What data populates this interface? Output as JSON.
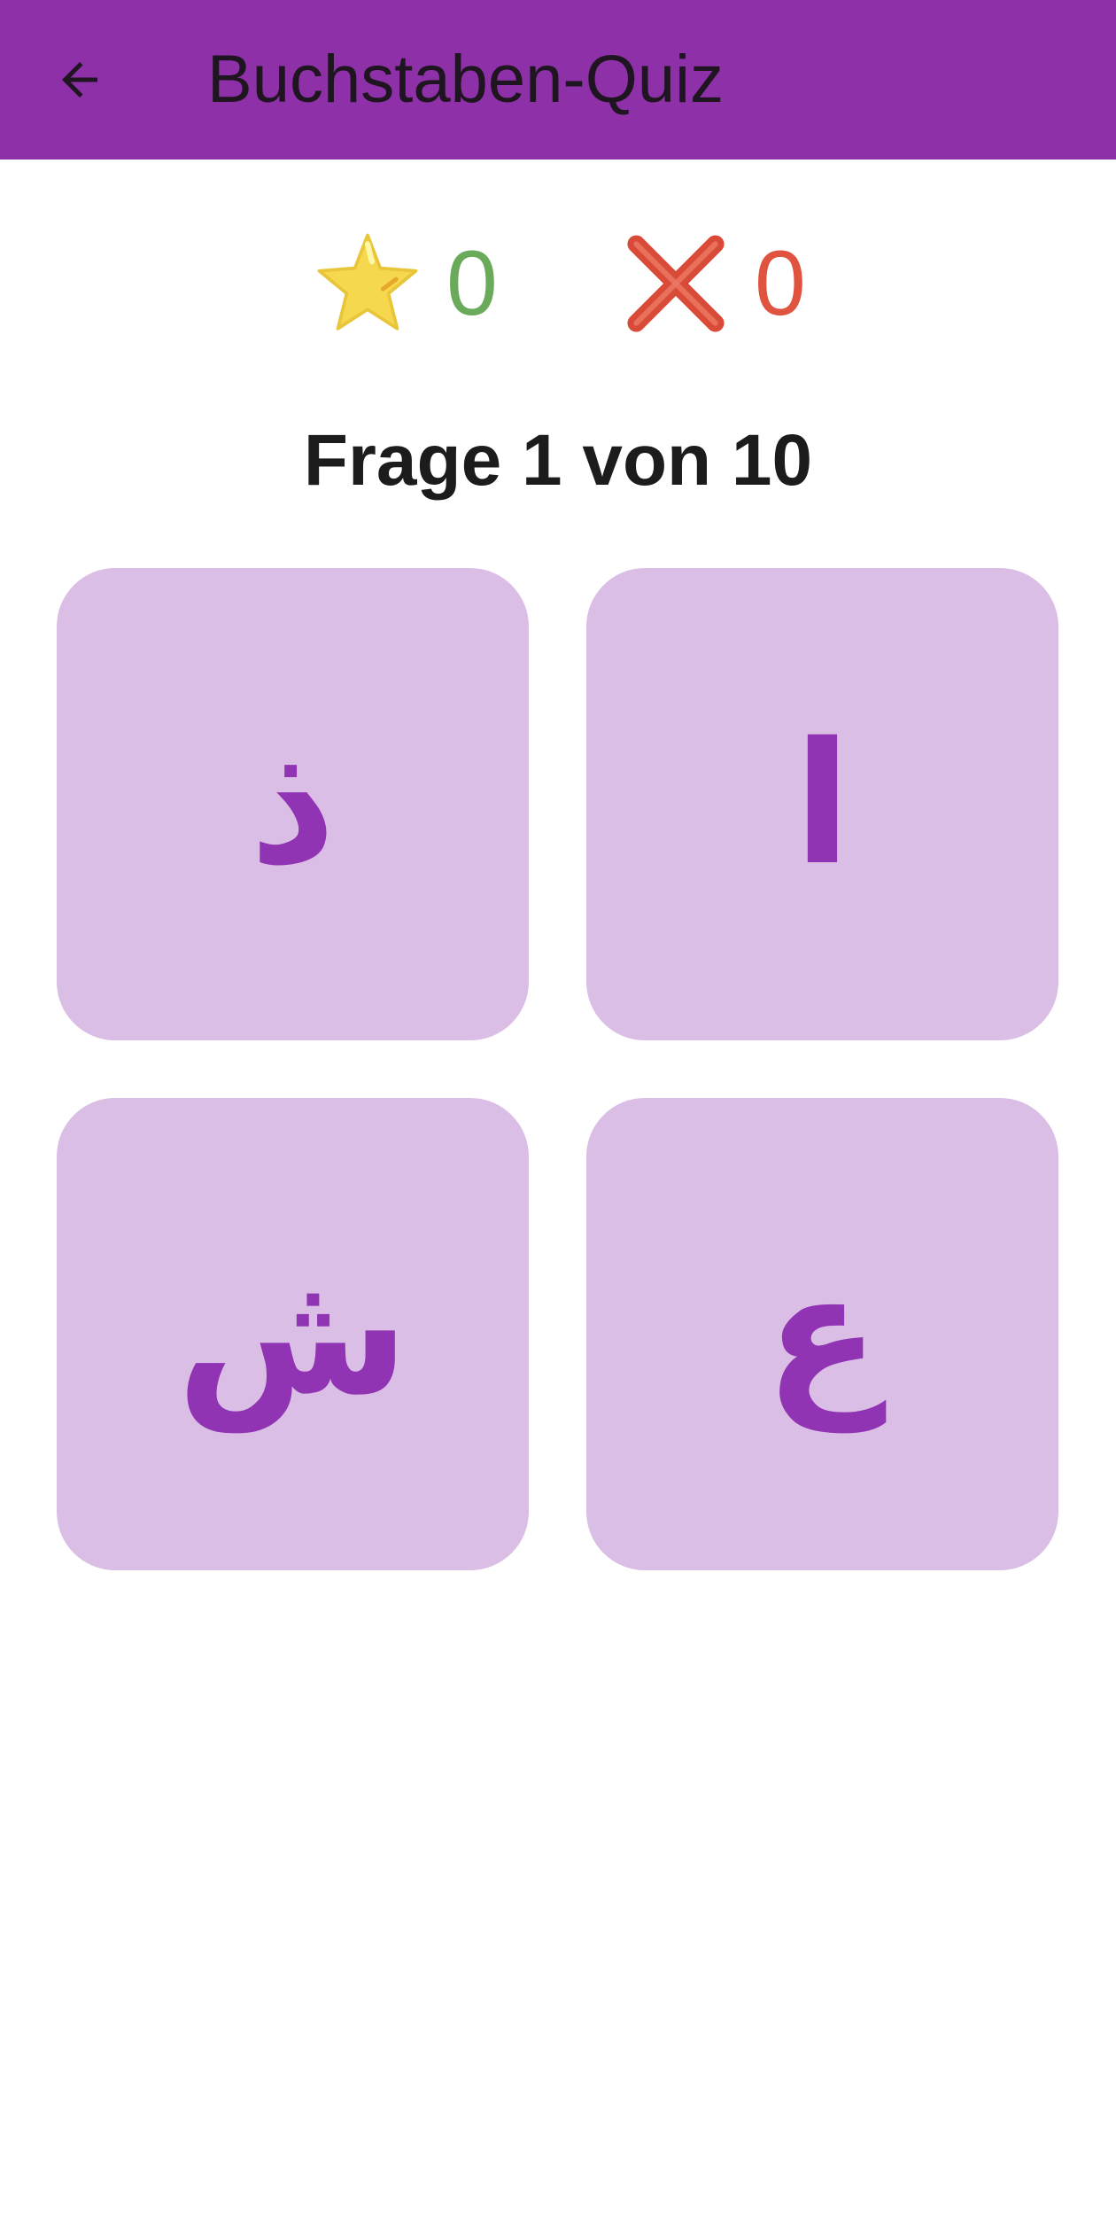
{
  "app_bar": {
    "title": "Buchstaben-Quiz",
    "background_color": "#8e31a8",
    "back_icon": "arrow-left-icon"
  },
  "score": {
    "correct": {
      "icon": "star-icon",
      "value": "0",
      "color": "#6aaa5b"
    },
    "wrong": {
      "icon": "cross-icon",
      "value": "0",
      "color": "#e0533f"
    }
  },
  "question": {
    "text": "Frage 1 von 10"
  },
  "options": [
    {
      "letter": "ذ"
    },
    {
      "letter": "ا"
    },
    {
      "letter": "ش"
    },
    {
      "letter": "ع"
    }
  ],
  "colors": {
    "card_background": "#dbbee6",
    "letter_color": "#9134b3"
  }
}
